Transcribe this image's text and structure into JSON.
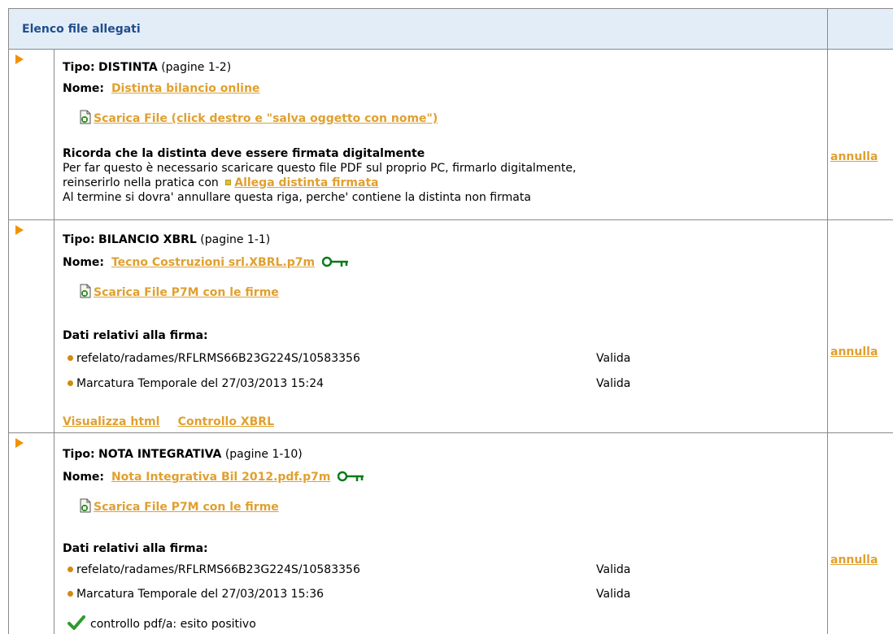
{
  "header": {
    "title": "Elenco file allegati"
  },
  "colors": {
    "link": "#e0a030",
    "header_bg": "#e3edf8",
    "title": "#1f4e8c",
    "arrow": "#f29100",
    "key": "#0a7a1a"
  },
  "rows": [
    {
      "tipo_label": "Tipo:",
      "tipo_value": "DISTINTA",
      "pagine": "(pagine 1-2)",
      "nome_label": "Nome:",
      "nome_link": "Distinta bilancio online",
      "download_link": "Scarica File (click destro e \"salva oggetto con nome\")",
      "note_title": "Ricorda che la distinta deve essere firmata digitalmente",
      "note_line1": "Per far questo è necessario scaricare questo file PDF sul proprio PC, firmarlo digitalmente,",
      "note_line2_prefix": "reinserirlo nella pratica con",
      "note_line2_link": "Allega distinta firmata",
      "note_line3": "Al termine si dovra' annullare questa riga, perche' contiene la distinta non firmata",
      "action": "annulla"
    },
    {
      "tipo_label": "Tipo:",
      "tipo_value": "BILANCIO XBRL",
      "pagine": "(pagine 1-1)",
      "nome_label": "Nome:",
      "nome_link": "Tecno Costruzioni srl.XBRL.p7m",
      "download_link": "Scarica File P7M con le firme",
      "firma_title": "Dati relativi alla firma:",
      "firme": [
        {
          "text": "refelato/radames/RFLRMS66B23G224S/10583356",
          "status": "Valida"
        },
        {
          "text": "Marcatura Temporale del 27/03/2013 15:24",
          "status": "Valida"
        }
      ],
      "link_html": "Visualizza html",
      "link_xbrl": "Controllo XBRL",
      "action": "annulla"
    },
    {
      "tipo_label": "Tipo:",
      "tipo_value": "NOTA INTEGRATIVA",
      "pagine": "(pagine 1-10)",
      "nome_label": "Nome:",
      "nome_link": "Nota Integrativa Bil 2012.pdf.p7m",
      "download_link": "Scarica File P7M con le firme",
      "firma_title": "Dati relativi alla firma:",
      "firme": [
        {
          "text": "refelato/radames/RFLRMS66B23G224S/10583356",
          "status": "Valida"
        },
        {
          "text": "Marcatura Temporale del 27/03/2013 15:36",
          "status": "Valida"
        }
      ],
      "pdfa_check": "controllo pdf/a: esito positivo",
      "action": "annulla"
    }
  ]
}
